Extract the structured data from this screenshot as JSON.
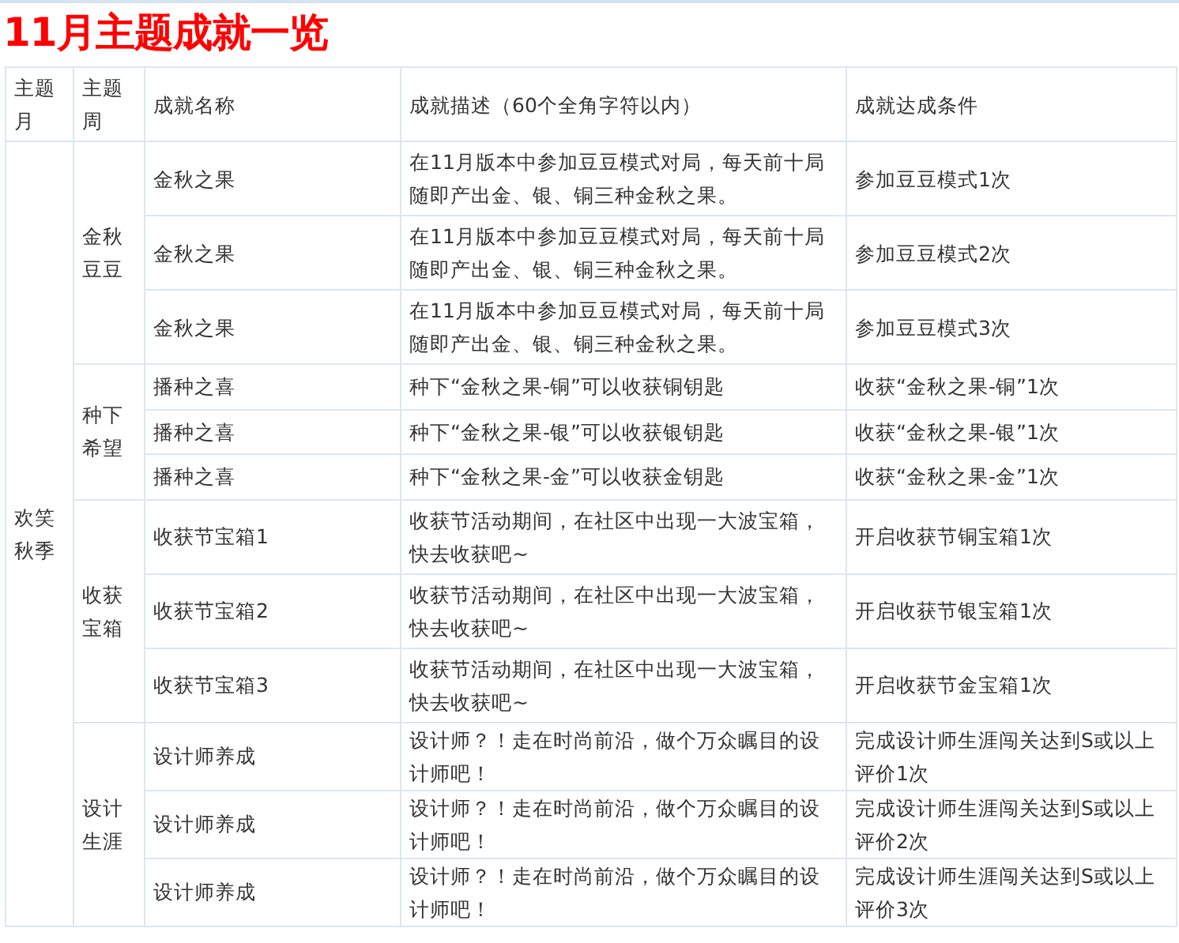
{
  "title": "11月主题成就一览",
  "table": {
    "columns": [
      "主题月",
      "主题周",
      "成就名称",
      "成就描述（60个全角字符以内）",
      "成就达成条件"
    ],
    "groups": [
      {
        "month": "欢笑秋季",
        "weeks": [
          {
            "week": "金秋豆豆",
            "rows": [
              {
                "name": "金秋之果",
                "description": "在11月版本中参加豆豆模式对局，每天前十局随即产出金、银、铜三种金秋之果。",
                "condition": "参加豆豆模式1次"
              },
              {
                "name": "金秋之果",
                "description": "在11月版本中参加豆豆模式对局，每天前十局随即产出金、银、铜三种金秋之果。",
                "condition": "参加豆豆模式2次"
              },
              {
                "name": "金秋之果",
                "description": "在11月版本中参加豆豆模式对局，每天前十局随即产出金、银、铜三种金秋之果。",
                "condition": "参加豆豆模式3次"
              }
            ]
          },
          {
            "week": "种下希望",
            "rows": [
              {
                "name": "播种之喜",
                "description": "种下“金秋之果-铜”可以收获铜钥匙",
                "condition": "收获“金秋之果-铜”1次"
              },
              {
                "name": "播种之喜",
                "description": "种下“金秋之果-银”可以收获银钥匙",
                "condition": "收获“金秋之果-银”1次"
              },
              {
                "name": "播种之喜",
                "description": "种下“金秋之果-金”可以收获金钥匙",
                "condition": "收获“金秋之果-金”1次"
              }
            ]
          },
          {
            "week": "收获宝箱",
            "rows": [
              {
                "name": "收获节宝箱1",
                "description": "收获节活动期间，在社区中出现一大波宝箱，快去收获吧~",
                "condition": "开启收获节铜宝箱1次"
              },
              {
                "name": "收获节宝箱2",
                "description": "收获节活动期间，在社区中出现一大波宝箱，快去收获吧~",
                "condition": "开启收获节银宝箱1次"
              },
              {
                "name": "收获节宝箱3",
                "description": "收获节活动期间，在社区中出现一大波宝箱，快去收获吧~",
                "condition": "开启收获节金宝箱1次"
              }
            ]
          },
          {
            "week": "设计生涯",
            "rows": [
              {
                "name": "设计师养成",
                "description": "设计师？！走在时尚前沿，做个万众瞩目的设计师吧！",
                "condition": "完成设计师生涯闯关达到S或以上评价1次"
              },
              {
                "name": "设计师养成",
                "description": "设计师？！走在时尚前沿，做个万众瞩目的设计师吧！",
                "condition": "完成设计师生涯闯关达到S或以上评价2次"
              },
              {
                "name": "设计师养成",
                "description": "设计师？！走在时尚前沿，做个万众瞩目的设计师吧！",
                "condition": "完成设计师生涯闯关达到S或以上评价3次"
              }
            ]
          }
        ]
      }
    ]
  }
}
